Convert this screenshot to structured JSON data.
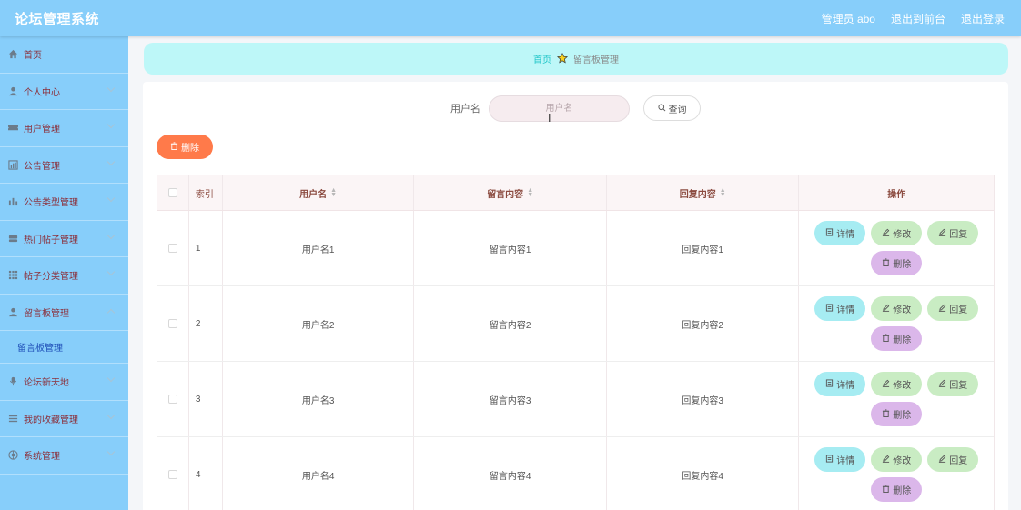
{
  "app": {
    "title": "论坛管理系统"
  },
  "topnav": {
    "admin": "管理员 abo",
    "front": "退出到前台",
    "logout": "退出登录"
  },
  "sidebar": {
    "items": [
      {
        "label": "首页",
        "icon": "home-icon",
        "expandable": false
      },
      {
        "label": "个人中心",
        "icon": "user-icon",
        "expandable": true
      },
      {
        "label": "用户管理",
        "icon": "ticket-icon",
        "expandable": true
      },
      {
        "label": "公告管理",
        "icon": "chart-icon",
        "expandable": true
      },
      {
        "label": "公告类型管理",
        "icon": "bar-chart-icon",
        "expandable": true
      },
      {
        "label": "热门帖子管理",
        "icon": "stack-icon",
        "expandable": true
      },
      {
        "label": "帖子分类管理",
        "icon": "grid-icon",
        "expandable": true
      },
      {
        "label": "留言板管理",
        "icon": "person-icon",
        "expandable": true,
        "expanded": true
      },
      {
        "label": "论坛新天地",
        "icon": "mic-icon",
        "expandable": true
      },
      {
        "label": "我的收藏管理",
        "icon": "list-icon",
        "expandable": true
      },
      {
        "label": "系统管理",
        "icon": "settings-icon",
        "expandable": true
      }
    ],
    "submenu": {
      "label": "留言板管理"
    }
  },
  "breadcrumb": {
    "home": "首页",
    "current": "留言板管理"
  },
  "search": {
    "label": "用户名",
    "placeholder": "用户名",
    "button": "查询"
  },
  "toolbar": {
    "delete_label": "删除"
  },
  "table": {
    "headers": {
      "index": "索引",
      "username": "用户名",
      "message": "留言内容",
      "reply": "回复内容",
      "ops": "操作"
    },
    "rows": [
      {
        "index": "1",
        "username": "用户名1",
        "message": "留言内容1",
        "reply": "回复内容1"
      },
      {
        "index": "2",
        "username": "用户名2",
        "message": "留言内容2",
        "reply": "回复内容2"
      },
      {
        "index": "3",
        "username": "用户名3",
        "message": "留言内容3",
        "reply": "回复内容3"
      },
      {
        "index": "4",
        "username": "用户名4",
        "message": "留言内容4",
        "reply": "回复内容4"
      }
    ],
    "ops": {
      "detail": "详情",
      "edit": "修改",
      "reply": "回复",
      "delete": "删除"
    }
  },
  "colors": {
    "header_bg": "#87cefa",
    "breadcrumb_bg": "#bdf7f8",
    "delete_btn": "#ff7a4a",
    "detail_btn": "#a6ecf2",
    "edit_btn": "#c9ecc3",
    "del_op_btn": "#dbb7ea"
  }
}
